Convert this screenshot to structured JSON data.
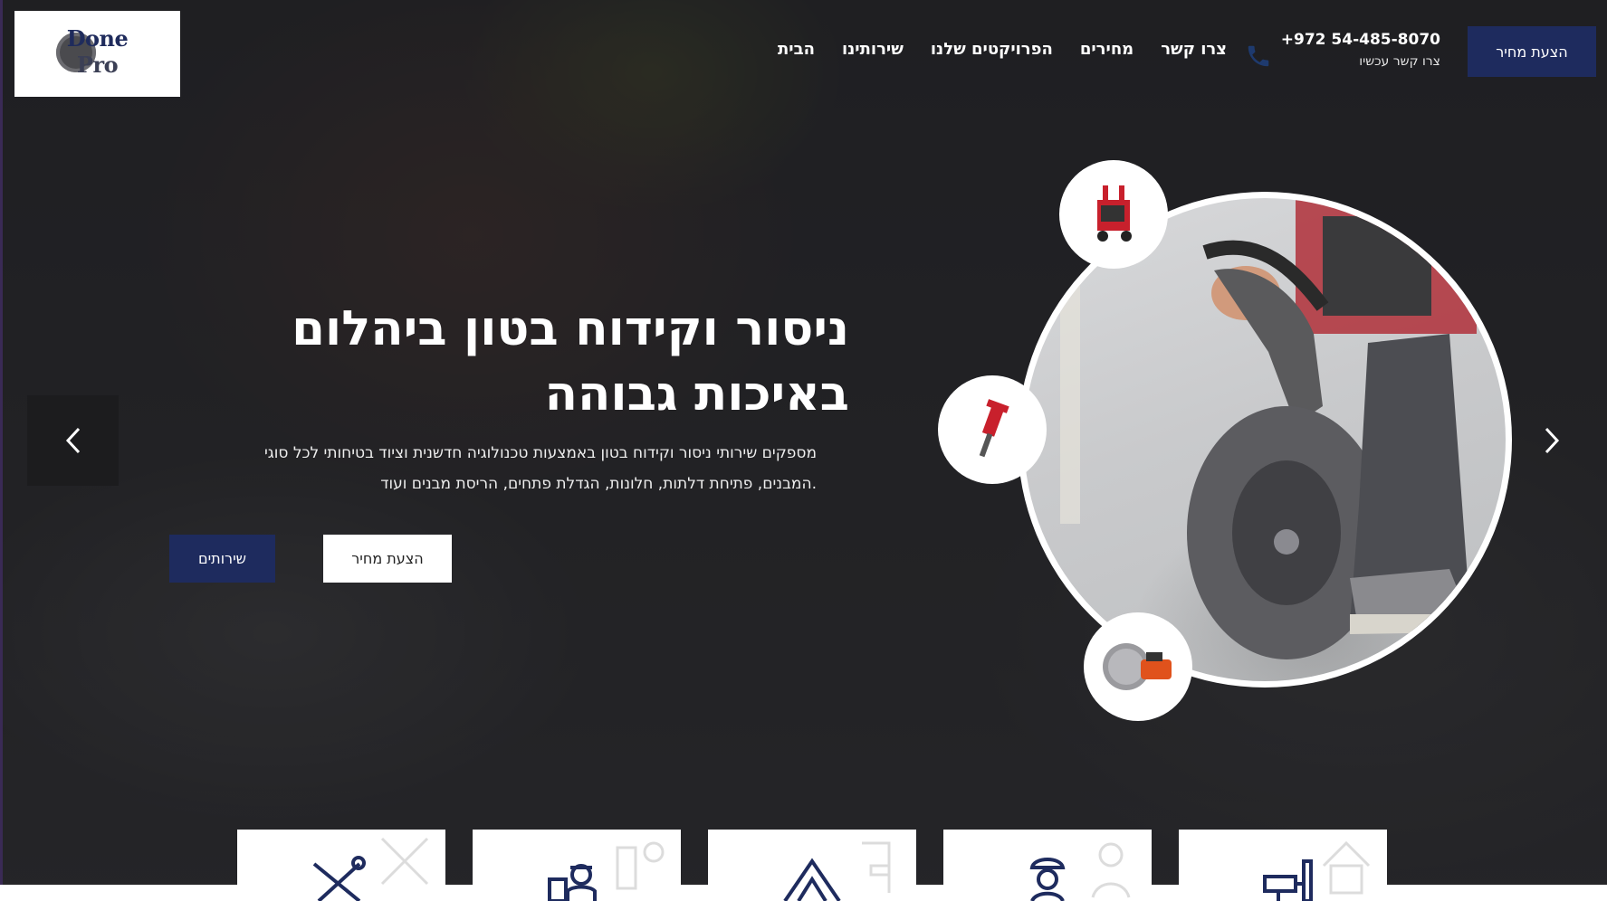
{
  "header": {
    "logo": {
      "word1": "Done",
      "word2": "Pro"
    },
    "nav": [
      {
        "label": "הבית"
      },
      {
        "label": "שירותינו"
      },
      {
        "label": "הפרויקטים שלנו"
      },
      {
        "label": "מחירים"
      },
      {
        "label": "צרו קשר"
      }
    ],
    "phone": {
      "number": "+972 54-485-8070",
      "sub": "צרו קשר עכשיו",
      "icon": "phone-icon"
    },
    "cta_label": "הצעת מחיר"
  },
  "hero": {
    "title_line1": "ניסור וקידוח בטון ביהלום",
    "title_line2": "באיכות גבוהה",
    "description_line1": "מספקים שירותי ניסור וקידוח בטון באמצעות טכנולוגיה חדשנית וציוד בטיחותי לכל סוגי",
    "description_line2": ".המבנים, פתיחת דלתות, חלונות, הגדלת פתחים, הריסת מבנים ועוד",
    "quote_button": "הצעת מחיר",
    "services_button": "שירותים"
  },
  "slider": {
    "prev_icon": "chevron-left-icon",
    "next_icon": "chevron-right-icon"
  },
  "colors": {
    "brand_navy": "#1e2b5e",
    "white": "#ffffff",
    "dark_overlay": "#1c1c1e"
  },
  "service_cards": [
    {
      "icon": "wrench-tools-icon"
    },
    {
      "icon": "technician-icon"
    },
    {
      "icon": "triangle-tool-icon"
    },
    {
      "icon": "worker-icon"
    },
    {
      "icon": "drill-icon"
    }
  ]
}
